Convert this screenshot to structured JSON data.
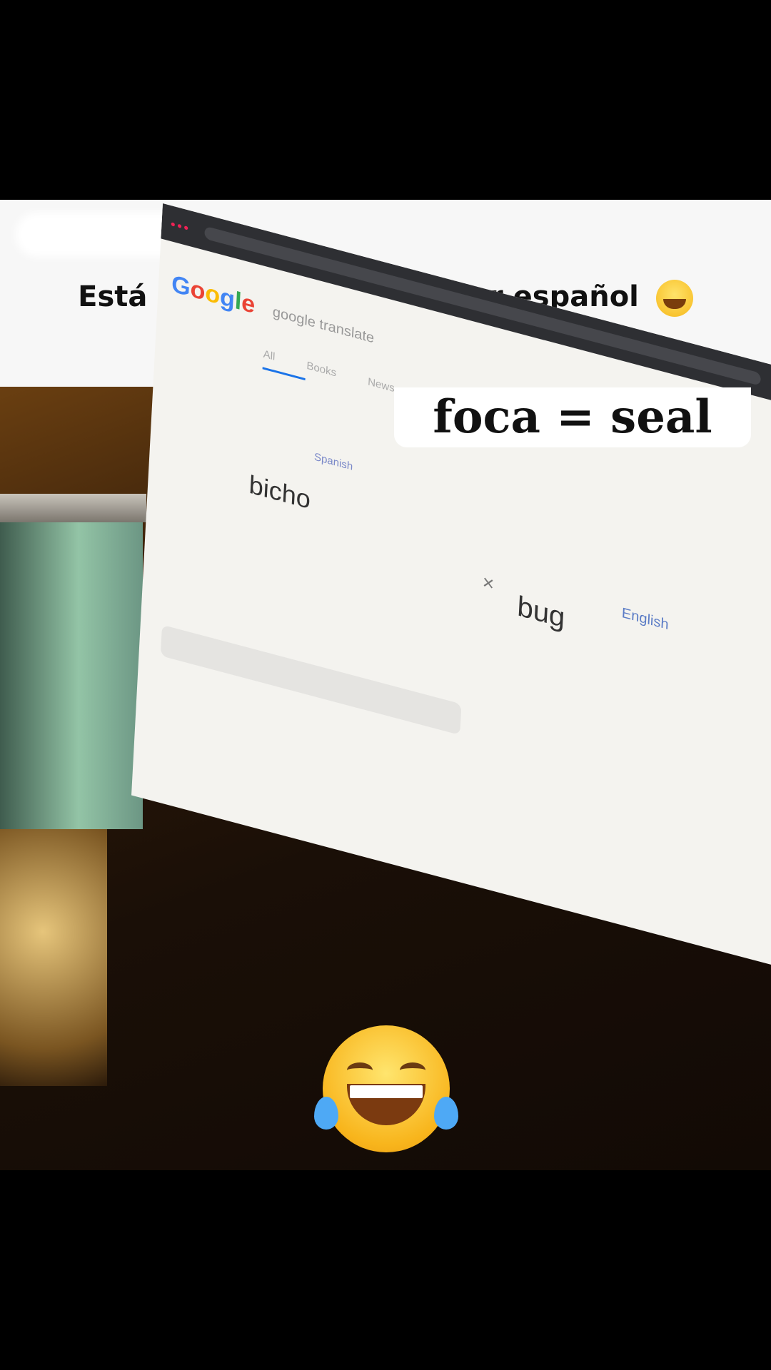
{
  "caption": {
    "text": "Está aprendiendo a hablar español"
  },
  "overlay": {
    "text": "foca = seal"
  },
  "screen": {
    "logo": "Google",
    "query": "google translate",
    "tabs": "All Books News Shopping Images More",
    "source_language": "Spanish",
    "target_language": "English",
    "source_word": "bicho",
    "translated_word": "bug"
  }
}
